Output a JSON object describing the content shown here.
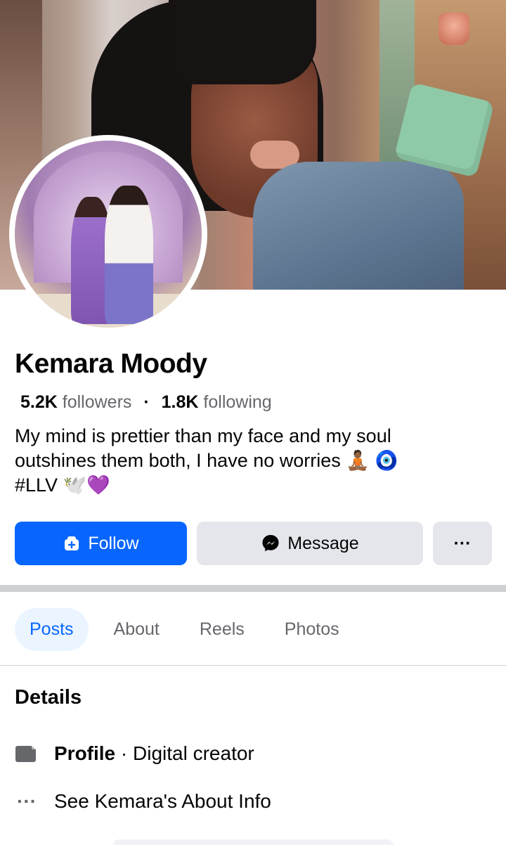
{
  "profile": {
    "name": "Kemara Moody",
    "followers_count": "5.2K",
    "followers_label": "followers",
    "separator": "·",
    "following_count": "1.8K",
    "following_label": "following",
    "bio_line1": "My mind is prettier than my face and my soul",
    "bio_line2": "outshines them both, I have no worries 🧘🏾 🧿",
    "bio_line3": "#LLV 🕊️💜"
  },
  "actions": {
    "follow_label": "Follow",
    "message_label": "Message",
    "more_label": "···"
  },
  "tabs": [
    {
      "label": "Posts",
      "active": true
    },
    {
      "label": "About",
      "active": false
    },
    {
      "label": "Reels",
      "active": false
    },
    {
      "label": "Photos",
      "active": false
    }
  ],
  "details": {
    "title": "Details",
    "profile_bold": "Profile",
    "profile_rest": " · Digital creator",
    "about_info": "See Kemara's About Info",
    "more_icon": "···"
  },
  "colors": {
    "accent": "#0866ff",
    "tab_active_bg": "#ebf5ff",
    "button_gray": "#e4e6eb",
    "secondary_text": "#65676b"
  },
  "icons": {
    "follow": "user-plus-icon",
    "message": "messenger-icon",
    "profile": "page-icon",
    "about": "more-horizontal-icon"
  }
}
